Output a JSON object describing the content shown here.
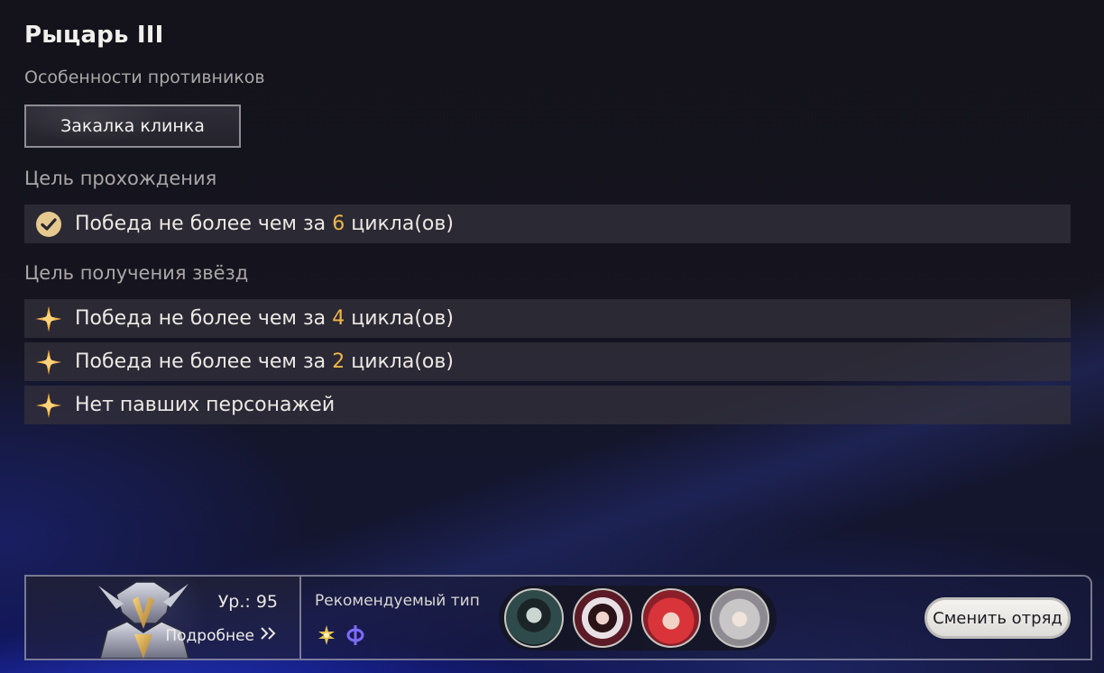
{
  "title": "Рыцарь III",
  "enemy_features": {
    "label": "Особенности противников",
    "button": "Закалка клинка"
  },
  "clear_goal": {
    "label": "Цель прохождения",
    "item": {
      "before": "Победа не более чем за",
      "num": "6",
      "after": "цикла(ов)",
      "icon": "check-circle-icon"
    }
  },
  "star_goals": {
    "label": "Цель получения звёзд",
    "items": [
      {
        "before": "Победа не более чем за",
        "num": "4",
        "after": "цикла(ов)",
        "icon": "star-icon"
      },
      {
        "before": "Победа не более чем за",
        "num": "2",
        "after": "цикла(ов)",
        "icon": "star-icon"
      },
      {
        "text": "Нет павших персонажей",
        "icon": "star-icon"
      }
    ]
  },
  "bottom": {
    "level": "Ур.: 95",
    "details": "Подробнее",
    "recommended_label": "Рекомендуемый тип",
    "elements": [
      "quantum-cross-icon",
      "imaginary-phi-icon"
    ],
    "swap_button": "Сменить отряд"
  },
  "colors": {
    "accent_number": "#f0b648",
    "row_bg": "#34323c",
    "star": "#f3b24a",
    "quantum": "#8f7bff"
  }
}
